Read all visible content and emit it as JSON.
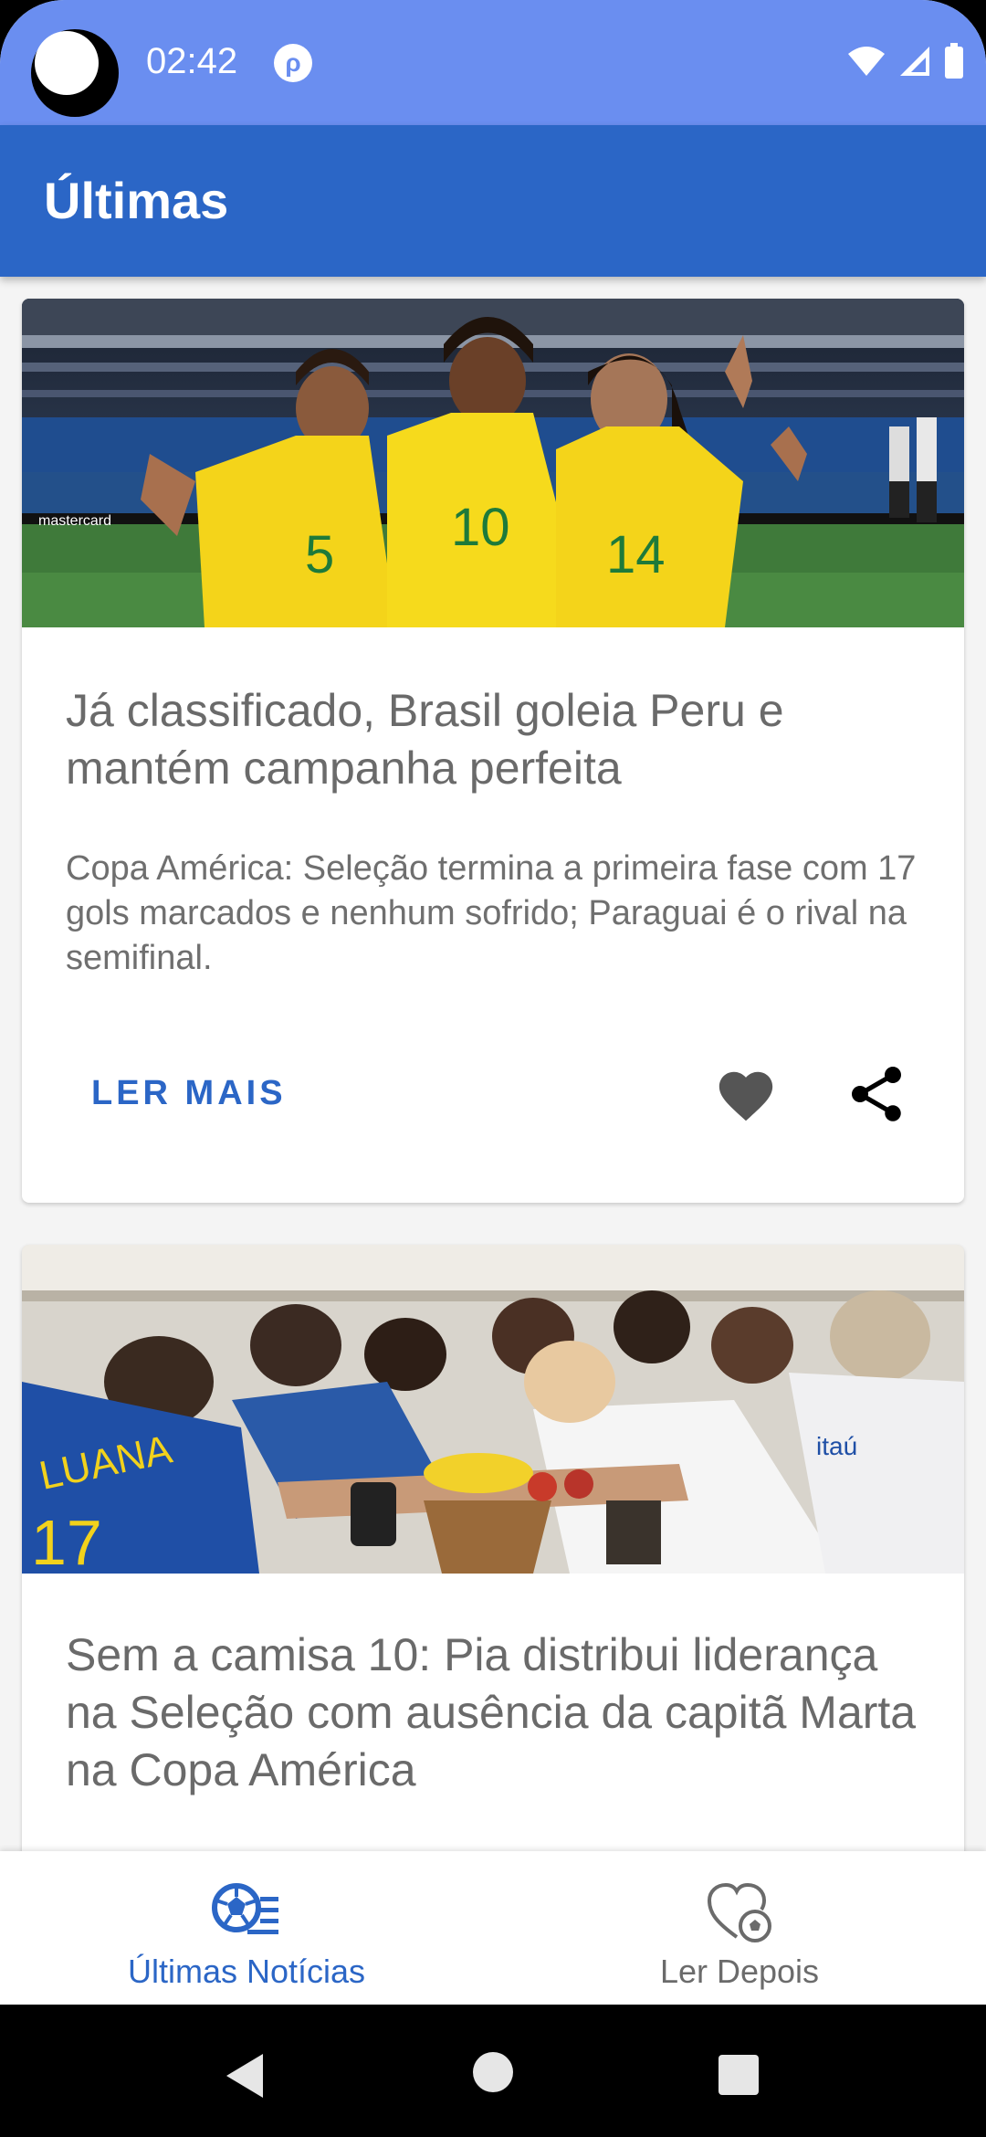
{
  "status_bar": {
    "time": "02:42",
    "notification_icon": "app-notification-icon",
    "icons": [
      "wifi-icon",
      "signal-icon",
      "battery-icon"
    ]
  },
  "app_bar": {
    "title": "Últimas"
  },
  "articles": [
    {
      "image": "photo-brazil-players-celebrating",
      "jersey_numbers": [
        "5",
        "10",
        "14"
      ],
      "sponsor": "mastercard",
      "title": "Já classificado, Brasil goleia Peru e mantém campanha perfeita",
      "summary": "Copa América: Seleção termina a primeira fase com 17 gols marcados e nenhum sofrido; Paraguai é o rival na semifinal.",
      "read_more_label": "LER MAIS",
      "actions": [
        "heart-icon",
        "share-icon"
      ]
    },
    {
      "image": "photo-team-huddle-locker-room",
      "jersey_name": "LUANA",
      "jersey_number": "17",
      "shirt_text": "itaú",
      "title": "Sem a camisa 10: Pia distribui liderança na Seleção com ausência da capitã Marta na Copa América"
    }
  ],
  "bottom_nav": [
    {
      "label": "Últimas Notícias",
      "icon": "soccer-ball-list-icon",
      "active": true
    },
    {
      "label": "Ler Depois",
      "icon": "heart-ball-icon",
      "active": false
    }
  ],
  "system_nav": [
    "back-icon",
    "home-icon",
    "recent-apps-icon"
  ],
  "colors": {
    "status_bar": "#6a8ef0",
    "app_bar": "#2b66c6",
    "accent": "#2b66c6",
    "title_text": "#6a6a6a"
  }
}
